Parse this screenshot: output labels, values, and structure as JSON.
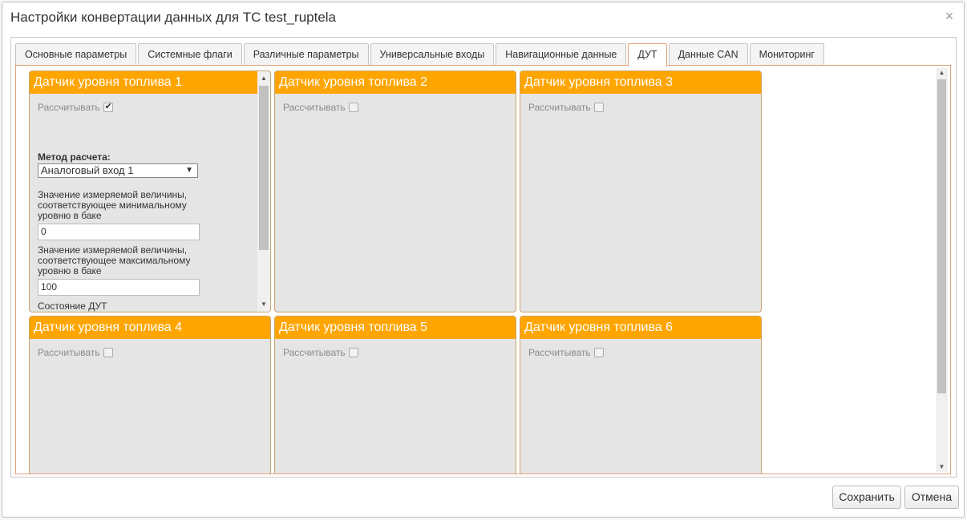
{
  "dialog": {
    "title": "Настройки конвертации данных для ТС test_ruptela",
    "close_glyph": "×"
  },
  "tabs": [
    {
      "label": "Основные параметры"
    },
    {
      "label": "Системные флаги"
    },
    {
      "label": "Различные параметры"
    },
    {
      "label": "Универсальные входы"
    },
    {
      "label": "Навигационные данные"
    },
    {
      "label": "ДУТ",
      "active": true
    },
    {
      "label": "Данные CAN"
    },
    {
      "label": "Мониторинг"
    }
  ],
  "panels": [
    {
      "title": "Датчик уровня топлива 1",
      "calc_label": "Рассчитывать",
      "calc_checked": true,
      "method_label": "Метод расчета:",
      "method_value": "Аналоговый вход 1",
      "min_desc": "Значение измеряемой величины, соответствующее минимальному уровню в баке",
      "min_value": "0",
      "max_desc": "Значение измеряемой величины, соответствующее максимальному уровню в баке",
      "max_value": "100",
      "state_label": "Состояние ДУТ"
    },
    {
      "title": "Датчик уровня топлива 2",
      "calc_label": "Рассчитывать",
      "calc_checked": false
    },
    {
      "title": "Датчик уровня топлива 3",
      "calc_label": "Рассчитывать",
      "calc_checked": false
    },
    {
      "title": "Датчик уровня топлива 4",
      "calc_label": "Рассчитывать",
      "calc_checked": false
    },
    {
      "title": "Датчик уровня топлива 5",
      "calc_label": "Рассчитывать",
      "calc_checked": false
    },
    {
      "title": "Датчик уровня топлива 6",
      "calc_label": "Рассчитывать",
      "calc_checked": false
    }
  ],
  "footer": {
    "save_label": "Сохранить",
    "cancel_label": "Отмена"
  },
  "colors": {
    "panel_header": "#ffa500",
    "tab_border_active": "#e0a27a"
  }
}
